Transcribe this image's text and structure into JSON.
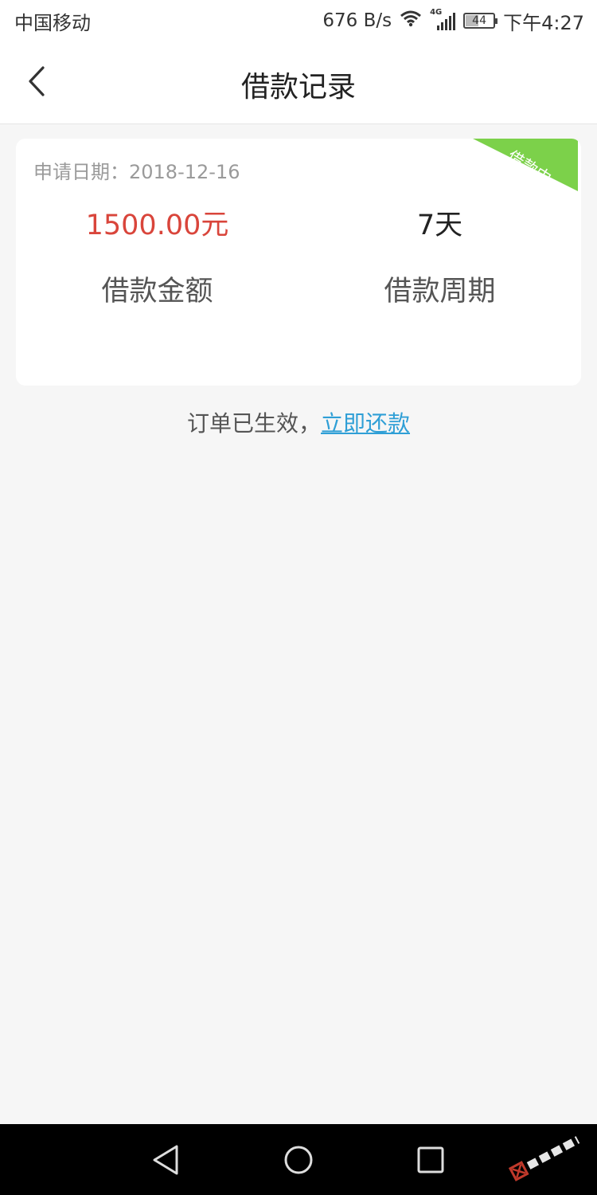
{
  "status_bar": {
    "carrier": "中国移动",
    "net_speed": "676 B/s",
    "network_type": "4G",
    "battery": "44",
    "time": "下午4:27"
  },
  "header": {
    "title": "借款记录"
  },
  "record": {
    "apply_date_label": "申请日期：",
    "apply_date": "2018-12-16",
    "status_badge": "借款中",
    "amount": "1500.00元",
    "amount_label": "借款金额",
    "period": "7天",
    "period_label": "借款周期"
  },
  "hint": {
    "text": "订单已生效，",
    "link": "立即还款"
  },
  "colors": {
    "amount": "#d9453b",
    "badge": "#7cd14a",
    "link": "#2f9fd6"
  }
}
